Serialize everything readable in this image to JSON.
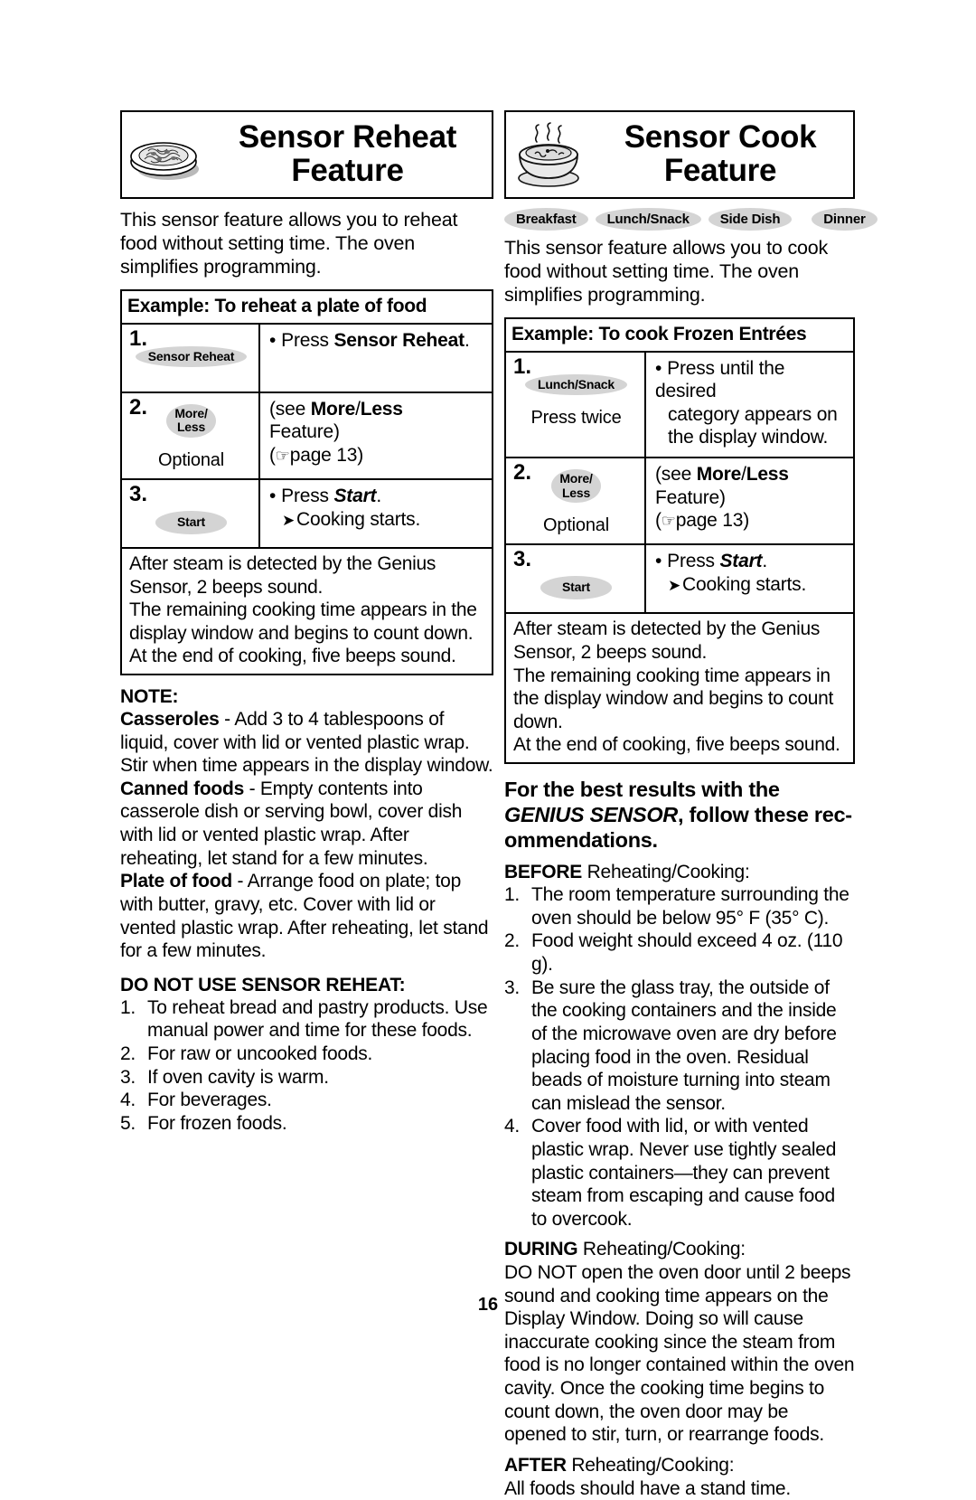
{
  "page": {
    "number": "16"
  },
  "left_column": {
    "banner": {
      "icon": "plate-of-food-icon",
      "title_line1": "Sensor Reheat",
      "title_line2": "Feature"
    },
    "intro": "This sensor feature allows you to reheat food without setting time. The oven simplifies programming.",
    "example": {
      "title": "Example: To reheat a plate of food",
      "rows": [
        {
          "number": "1.",
          "button": "Sensor Reheat",
          "sub": "",
          "desc_bullet": "Press",
          "desc_bold": "Sensor Reheat",
          "desc_tail": "."
        },
        {
          "number": "2.",
          "button_line1": "More/",
          "button_line2": "Less",
          "sub": "Optional",
          "desc_l1_pre": "(see ",
          "desc_l1_bold1": "More",
          "desc_l1_mid": "/",
          "desc_l1_bold2": "Less",
          "desc_l2": "Feature)",
          "desc_l3": "(",
          "desc_l3_page": "page 13)"
        },
        {
          "number": "3.",
          "button": "Start",
          "sub": "",
          "desc_bullet": "Press",
          "desc_italic": "Start",
          "desc_tail": ".",
          "desc_arrow": "Cooking starts."
        }
      ],
      "footer": "After steam is detected by the Genius Sensor, 2 beeps sound.\nThe remaining cooking time appears in the display window and begins to count down.\nAt the end of cooking, five beeps sound."
    },
    "note": {
      "heading": "NOTE:",
      "items": [
        {
          "term": "Casseroles",
          "text": " - Add 3 to 4 tablespoons of liquid, cover with lid or vented plastic wrap. Stir when time appears in the display window."
        },
        {
          "term": "Canned foods",
          "text": " - Empty contents into casserole dish or serving bowl, cover dish with lid or vented plastic wrap. After reheating, let stand for a few minutes."
        },
        {
          "term": "Plate of food",
          "text": " - Arrange food on plate; top with butter, gravy, etc. Cover with lid or vented plastic wrap. After reheating, let stand for a few minutes."
        }
      ]
    },
    "do_not_use": {
      "heading": "DO NOT USE SENSOR REHEAT:",
      "items": [
        {
          "n": "1.",
          "text": "To reheat bread and pastry products. Use manual power and time for these foods."
        },
        {
          "n": "2.",
          "text": "For raw or uncooked foods."
        },
        {
          "n": "3.",
          "text": "If oven cavity is warm."
        },
        {
          "n": "4.",
          "text": "For beverages."
        },
        {
          "n": "5.",
          "text": "For frozen foods."
        }
      ]
    }
  },
  "right_column": {
    "banner": {
      "icon": "steaming-bowl-icon",
      "title_line1": "Sensor Cook",
      "title_line2": "Feature"
    },
    "badges": [
      "Breakfast",
      "Lunch/Snack",
      "Side Dish",
      "Dinner"
    ],
    "intro": "This sensor feature allows you to cook food without setting time. The oven simplifies programming.",
    "example": {
      "title": "Example: To cook Frozen Entrées",
      "rows": [
        {
          "number": "1.",
          "button": "Lunch/Snack",
          "sub": "Press twice",
          "desc_bullet": "Press until the desired",
          "desc_l2": "category appears on",
          "desc_l3": "the display window."
        },
        {
          "number": "2.",
          "button_line1": "More/",
          "button_line2": "Less",
          "sub": "Optional",
          "desc_l1_pre": "(see ",
          "desc_l1_bold1": "More",
          "desc_l1_mid": "/",
          "desc_l1_bold2": "Less",
          "desc_l2": "Feature)",
          "desc_l3": "(",
          "desc_l3_page": "page 13)"
        },
        {
          "number": "3.",
          "button": "Start",
          "sub": "",
          "desc_bullet": "Press",
          "desc_italic": "Start",
          "desc_tail": ".",
          "desc_arrow": "Cooking starts."
        }
      ],
      "footer": "After steam is detected by the Genius Sensor, 2 beeps sound.\nThe remaining cooking time appears in the display window and begins to count down.\nAt the end of cooking, five beeps sound."
    },
    "best_results": {
      "line1": "For the best results with the",
      "line2_italic": "GENIUS SENSOR",
      "line2_rest": ", follow these rec-",
      "line3": "ommendations."
    },
    "before": {
      "label": "BEFORE",
      "label_rest": " Reheating/Cooking:",
      "items": [
        {
          "n": "1.",
          "text": "The room temperature surrounding the oven should be below 95° F (35° C)."
        },
        {
          "n": "2.",
          "text": "Food weight should exceed 4 oz. (110 g)."
        },
        {
          "n": "3.",
          "text": "Be sure the glass tray, the outside of the cooking containers and the inside of the microwave oven are dry before placing food in the oven. Residual beads of moisture turning into steam can mislead the sensor."
        },
        {
          "n": "4.",
          "text": "Cover food with lid, or with vented plastic wrap. Never use tightly sealed plastic containers—they can prevent steam from escaping and cause food to overcook."
        }
      ]
    },
    "during": {
      "label": "DURING",
      "label_rest": " Reheating/Cooking:",
      "text": "DO NOT open the oven door until 2 beeps sound and cooking time appears on the Display Window.  Doing so will cause inaccurate cooking since the steam from food is no longer contained within the oven cavity. Once the cooking time begins to count down, the oven door may be opened to stir, turn, or rearrange foods."
    },
    "after": {
      "label": "AFTER",
      "label_rest": " Reheating/Cooking:",
      "text": "All foods should have a stand time."
    }
  }
}
